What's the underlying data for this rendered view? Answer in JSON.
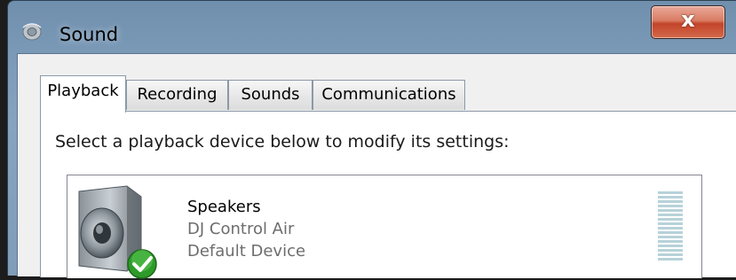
{
  "window": {
    "title": "Sound",
    "close_glyph": "x",
    "app_icon": "sound-icon"
  },
  "tabs": [
    {
      "label": "Playback",
      "active": true
    },
    {
      "label": "Recording",
      "active": false
    },
    {
      "label": "Sounds",
      "active": false
    },
    {
      "label": "Communications",
      "active": false
    }
  ],
  "panel": {
    "instruction": "Select a playback device below to modify its settings:"
  },
  "devices": [
    {
      "name": "Speakers",
      "description": "DJ Control Air",
      "status": "Default Device",
      "icon": "speaker-icon",
      "badge_icon": "default-check-icon",
      "level": 0
    }
  ],
  "colors": {
    "title_bar": "#7b9ab8",
    "close_button": "#c2442a",
    "check_badge": "#2e9a2a",
    "meter_segment": "#b7d2da"
  }
}
